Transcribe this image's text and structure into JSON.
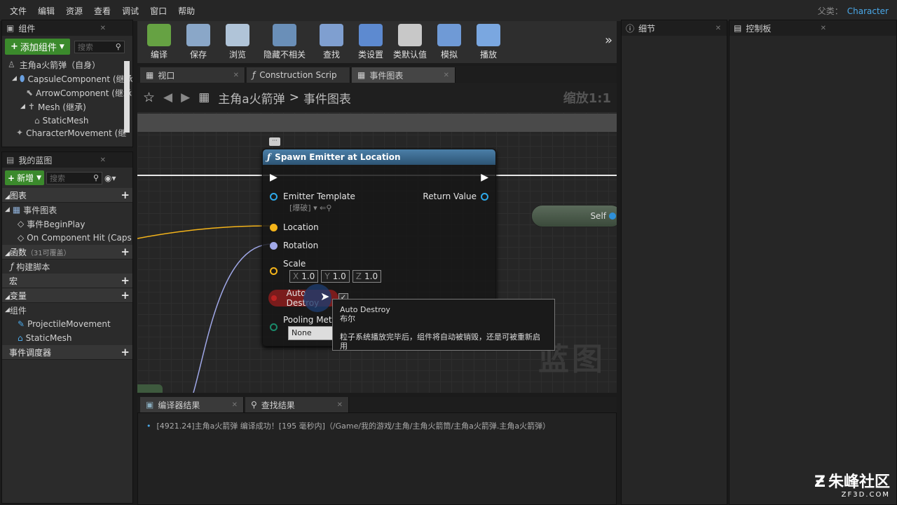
{
  "menu": {
    "items": [
      "文件",
      "编辑",
      "资源",
      "查看",
      "调试",
      "窗口",
      "帮助"
    ],
    "parent_label": "父类：",
    "parent_value": "Character"
  },
  "components": {
    "tab_title": "组件",
    "add_button": "添加组件",
    "search_placeholder": "搜索",
    "items": [
      "主角a火箭弹（自身）",
      "CapsuleComponent (继承",
      "ArrowComponent (继承",
      "Mesh (继承)",
      "StaticMesh",
      "CharacterMovement (继"
    ]
  },
  "myblueprint": {
    "tab_title": "我的蓝图",
    "new_button": "新增",
    "search_placeholder": "搜索",
    "graphs_label": "图表",
    "event_graph": "事件图表",
    "event_begin": "事件BeginPlay",
    "event_hit": "On Component Hit (Caps",
    "functions_label": "函数",
    "functions_count": "（31可覆盖）",
    "construct": "构建脚本",
    "macros_label": "宏",
    "variables_label": "变量",
    "components_label": "组件",
    "var_items": [
      "ProjectileMovement",
      "StaticMesh"
    ],
    "dispatchers_label": "事件调度器"
  },
  "toolbar": {
    "buttons": [
      "编译",
      "保存",
      "浏览",
      "隐藏不相关",
      "查找",
      "类设置",
      "类默认值",
      "模拟",
      "播放"
    ],
    "colors": [
      "#66a243",
      "#8aa7c8",
      "#b0c4d8",
      "#6a8fb8",
      "#7f9fd0",
      "#5d8ad0",
      "#c8c8c8",
      "#6f9ad6",
      "#7aa7e0"
    ]
  },
  "tabs": {
    "viewport": "视口",
    "construction": "Construction Scrip",
    "event_graph": "事件图表"
  },
  "graph": {
    "breadcrumb_root": "主角a火箭弹",
    "breadcrumb_sep": ">",
    "breadcrumb_leaf": "事件图表",
    "zoom": "缩放1:1",
    "watermark": "蓝图",
    "self_label": "Self"
  },
  "node": {
    "title": "Spawn Emitter at Location",
    "emitter_template": "Emitter Template",
    "emitter_value": "爆破",
    "return_value": "Return Value",
    "location": "Location",
    "rotation": "Rotation",
    "scale": "Scale",
    "scale_x": "1.0",
    "scale_y": "1.0",
    "scale_z": "1.0",
    "auto_destroy": "Auto Destroy",
    "pooling": "Pooling Meth",
    "pooling_value": "None"
  },
  "tooltip": {
    "title": "Auto Destroy",
    "type": "布尔",
    "desc": "粒子系统播放完毕后，组件将自动被销毁，还是可被重新启用"
  },
  "right_panels": {
    "details": "细节",
    "palette": "控制板"
  },
  "bottom": {
    "compiler_tab": "编译器结果",
    "find_tab": "查找结果",
    "log": "[4921.24]主角a火箭弹 编译成功！[195 毫秒内]（/Game/我的游戏/主角/主角火箭筒/主角a火箭弹.主角a火箭弹）"
  },
  "site_logo": {
    "name": "朱峰社区",
    "url": "ZF3D.COM"
  }
}
